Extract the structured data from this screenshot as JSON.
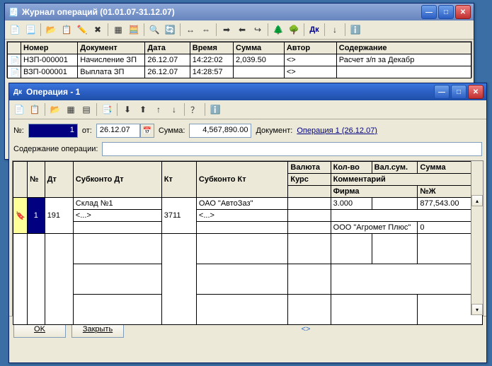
{
  "journal": {
    "title": "Журнал операций (01.01.07-31.12.07)",
    "columns": {
      "num": "Номер",
      "doc": "Документ",
      "date": "Дата",
      "time": "Время",
      "sum": "Сумма",
      "author": "Автор",
      "content": "Содержание"
    },
    "rows": [
      {
        "num": "НЗП-000001",
        "doc": "Начисление ЗП",
        "date": "26.12.07",
        "time": "14:22:02",
        "sum": "2,039.50",
        "author": "<>",
        "content": "Расчет з/п за Декабр"
      },
      {
        "num": "ВЗП-000001",
        "doc": "Выплата ЗП",
        "date": "26.12.07",
        "time": "14:28:57",
        "sum": "",
        "author": "<>",
        "content": ""
      }
    ]
  },
  "op": {
    "title": "Операция - 1",
    "labels": {
      "num": "№:",
      "from": "от:",
      "sum": "Сумма:",
      "doc": "Документ:",
      "content": "Содержание операции:"
    },
    "values": {
      "num": "1",
      "date": "26.12.07",
      "sum": "4,567,890.00"
    },
    "doclink": "Операция 1 (26.12.07)",
    "columns": {
      "n": "№",
      "dt": "Дт",
      "subdt": "Субконто Дт",
      "kt": "Кт",
      "subkt": "Субконто Кт",
      "cur": "Валюта",
      "qty": "Кол-во",
      "valsum": "Вал.сум.",
      "sum": "Сумма",
      "course": "Курс",
      "comment": "Комментарий",
      "firm": "Фирма",
      "nj": "№Ж"
    },
    "row": {
      "n": "1",
      "dt": "191",
      "subdt1": "Склад №1",
      "subdt2": "<...>",
      "kt": "3711",
      "subkt1": "ОАО \"АвтоЗаз\"",
      "subkt2": "<...>",
      "qty": "3.000",
      "sum": "877,543.00",
      "firm": "ООО \"Агромет Плюс\"",
      "nj": "0"
    },
    "buttons": {
      "ok": "OK",
      "close": "Закрыть"
    }
  }
}
